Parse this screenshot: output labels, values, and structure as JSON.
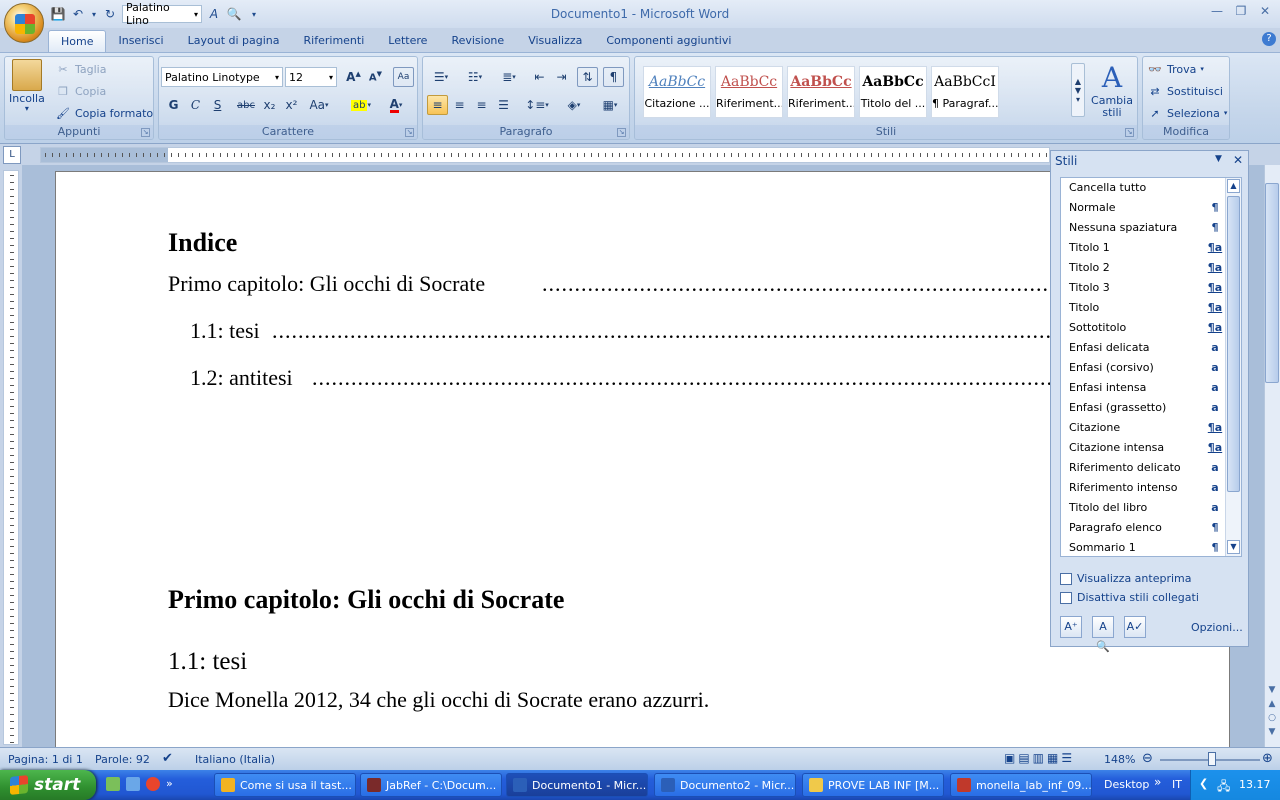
{
  "window": {
    "title": "Documento1 - Microsoft Word"
  },
  "qat": {
    "font": "Palatino Lino"
  },
  "tabs": [
    "Home",
    "Inserisci",
    "Layout di pagina",
    "Riferimenti",
    "Lettere",
    "Revisione",
    "Visualizza",
    "Componenti aggiuntivi"
  ],
  "ribbon": {
    "clipboard": {
      "label": "Appunti",
      "paste": "Incolla",
      "cut": "Taglia",
      "copy": "Copia",
      "format_painter": "Copia formato"
    },
    "font": {
      "label": "Carattere",
      "family": "Palatino Linotype",
      "size": "12",
      "bold": "G",
      "italic": "C",
      "underline": "S",
      "strike": "abc",
      "sub": "x₂",
      "sup": "x²",
      "case": "Aa"
    },
    "paragraph": {
      "label": "Paragrafo"
    },
    "styles": {
      "label": "Stili",
      "change_styles": "Cambia stili",
      "gallery": [
        {
          "preview": "AaBbCc",
          "name": "Citazione ...",
          "color": "#4f81bd"
        },
        {
          "preview": "AaBbCc",
          "name": "Riferiment...",
          "color": "#c0504d"
        },
        {
          "preview": "AaBbCc",
          "name": "Riferiment...",
          "color": "#c0504d"
        },
        {
          "preview": "AaBbCc",
          "name": "Titolo del ...",
          "color": "#000000"
        },
        {
          "preview": "AaBbCcI",
          "name": "¶ Paragraf...",
          "color": "#000000"
        }
      ]
    },
    "editing": {
      "label": "Modifica",
      "find": "Trova",
      "replace": "Sostituisci",
      "select": "Seleziona"
    }
  },
  "document": {
    "toc_title": "Indice",
    "toc": [
      {
        "text": "Primo capitolo: Gli occhi di Socrate",
        "indent": false
      },
      {
        "text": "1.1: tesi",
        "indent": true
      },
      {
        "text": "1.2: antitesi",
        "indent": true
      }
    ],
    "h1": "Primo capitolo: Gli occhi di Socrate",
    "h2": "1.1: tesi",
    "body": "Dice Monella 2012, 34 che gli occhi di Socrate erano azzurri."
  },
  "styles_pane": {
    "title": "Stili",
    "items": [
      {
        "name": "Cancella tutto",
        "mark": ""
      },
      {
        "name": "Normale",
        "mark": "¶"
      },
      {
        "name": "Nessuna spaziatura",
        "mark": "¶"
      },
      {
        "name": "Titolo 1",
        "mark": "¶a"
      },
      {
        "name": "Titolo 2",
        "mark": "¶a"
      },
      {
        "name": "Titolo 3",
        "mark": "¶a"
      },
      {
        "name": "Titolo",
        "mark": "¶a"
      },
      {
        "name": "Sottotitolo",
        "mark": "¶a"
      },
      {
        "name": "Enfasi delicata",
        "mark": "a"
      },
      {
        "name": "Enfasi (corsivo)",
        "mark": "a"
      },
      {
        "name": "Enfasi intensa",
        "mark": "a"
      },
      {
        "name": "Enfasi (grassetto)",
        "mark": "a"
      },
      {
        "name": "Citazione",
        "mark": "¶a"
      },
      {
        "name": "Citazione intensa",
        "mark": "¶a"
      },
      {
        "name": "Riferimento delicato",
        "mark": "a"
      },
      {
        "name": "Riferimento intenso",
        "mark": "a"
      },
      {
        "name": "Titolo del libro",
        "mark": "a"
      },
      {
        "name": "Paragrafo elenco",
        "mark": "¶"
      },
      {
        "name": "Sommario 1",
        "mark": "¶"
      }
    ],
    "show_preview": "Visualizza anteprima",
    "disable_linked": "Disattiva stili collegati",
    "options": "Opzioni..."
  },
  "statusbar": {
    "page": "Pagina: 1 di 1",
    "words": "Parole: 92",
    "language": "Italiano (Italia)",
    "zoom": "148%"
  },
  "taskbar": {
    "start": "start",
    "items": [
      {
        "label": "Come si usa il tast...",
        "color": "#f2b322",
        "active": false
      },
      {
        "label": "JabRef - C:\\Docum...",
        "color": "#7a2a2a",
        "active": false
      },
      {
        "label": "Documento1 - Micr...",
        "color": "#2b5fb8",
        "active": true
      },
      {
        "label": "Documento2 - Micr...",
        "color": "#2b5fb8",
        "active": false
      },
      {
        "label": "PROVE LAB INF [M...",
        "color": "#f0c94a",
        "active": false
      },
      {
        "label": "monella_lab_inf_09...",
        "color": "#c0392b",
        "active": false
      }
    ],
    "desktop": "Desktop",
    "lang": "IT",
    "time": "13.17"
  }
}
